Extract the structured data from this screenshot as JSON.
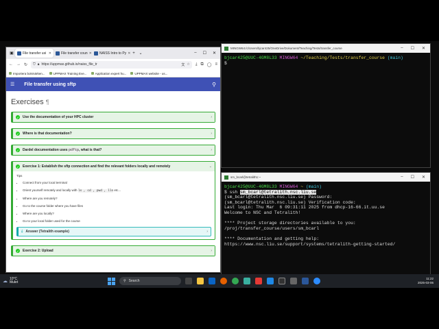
{
  "browser": {
    "tabs": [
      {
        "label": "File transfer usi",
        "active": true
      },
      {
        "label": "File transfer coun",
        "active": false
      },
      {
        "label": "NAISS Intro to Py",
        "active": false
      }
    ],
    "new_tab": "+",
    "url": "https://uppmax.github.io/naiss_file_tr",
    "bookmarks": [
      "Importera bokmärken...",
      "UPPMAX Training Eve...",
      "Application expert hu...",
      "UPPMAX website - us..."
    ],
    "site_title": "File transfer using sftp",
    "page_heading": "Exercises",
    "pilcrow": "¶",
    "collapsed_items": [
      "Use the documentation of your HPC cluster",
      "Where is that documentation?"
    ],
    "dardel_item": {
      "prefix": "Dardel documentation uses",
      "code": "pdftp",
      "suffix": ", what is that?"
    },
    "exercise1": {
      "title": "Exercise 1: Establish the sftp connection and find the relevant folders locally and remotely",
      "tips": "Tips",
      "bullets": [
        {
          "text": "Connect from your local terminal"
        },
        {
          "text": "Orient yourself remotely and locally with",
          "code": "ls , cd , pwd , lls",
          "suffix": " etc..."
        },
        {
          "text": "Where are you remotely?"
        },
        {
          "text": "Go to the course folder where you have files"
        },
        {
          "text": "Where are you locally?"
        },
        {
          "text": "Go to your local folder used for the course"
        }
      ],
      "answer": "Answer (Tetralith example)"
    },
    "exercise2": "Exercise 2: Upload"
  },
  "terminal1": {
    "title": "MINGW64:/c/Users/bjcar425/OneDrive/Dokument/Teaching/Tests/transfer_course",
    "user": "bjcar425@UUC-4GM8L33",
    "env": "MINGW64",
    "path": "~/Teaching/Tests/transfer_course",
    "branch": "(main)",
    "prompt": "$"
  },
  "terminal2": {
    "title": "sm_bcarl@tetralith1:~",
    "user": "bjcar425@UUC-4GM8L33",
    "env": "MINGW64",
    "path": "~",
    "branch": "(main)",
    "cmd_prefix": "$ ssh ",
    "cmd_target": "sm_bcarl@tetralith.nsc.liu.se",
    "lines": [
      "(sm_bcarl@tetralith.nsc.liu.se) Password:",
      "(sm_bcarl@tetralith.nsc.liu.se) Verification code:",
      "Last login: Thu Mar  6 09:31:11 2025 from dhcp-16-66.it.uu.se",
      "Welcome to NSC and Tetralith!",
      "",
      "**** Project storage directories available to you:",
      "/proj/transfer_course/users/sm_bcarl",
      "",
      "**** Documentation and getting help:",
      "https://www.nsc.liu.se/support/systems/tetralith-getting-started/"
    ]
  },
  "taskbar": {
    "temperature": "10°C",
    "weather": "Mulet",
    "search_placeholder": "Search",
    "time": "11:22",
    "date": "2025-03-06"
  }
}
